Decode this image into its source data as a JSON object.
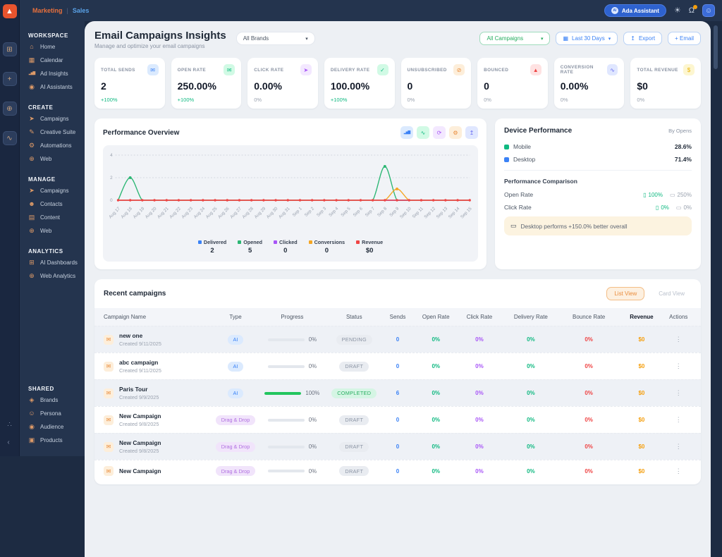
{
  "icons": {
    "logo": "▲",
    "grid": "⊞",
    "plus": "+",
    "globe": "⊕",
    "chart-line": "∿",
    "share": "∴",
    "collapse": "‹",
    "home": "⌂",
    "calendar": "▦",
    "ad-insights": "▂▅▇",
    "ai-assistants": "◉",
    "campaigns": "➤",
    "creative-suite": "✎",
    "automations": "⚙",
    "web": "⊕",
    "contacts": "☻",
    "content": "▤",
    "ai-dashboards": "⊞",
    "web-analytics": "⊕",
    "brands": "◈",
    "persona": "☺",
    "audience": "◉",
    "products": "▣",
    "envelope": "✉",
    "envelope-open": "✉",
    "cursor": "➤",
    "check": "✓",
    "user-minus": "⊘",
    "warning": "▲",
    "dollar": "$",
    "bar-chart": "▂▅▇",
    "refresh": "⟳",
    "settings": "⚙",
    "export": "↥",
    "sun": "☀",
    "bell": "Ω",
    "avatar": "☺",
    "dots": "⋮",
    "phone": "▯",
    "monitor": "▭",
    "chevron-down": "▾",
    "mail-row": "✉"
  },
  "topbar": {
    "nav": [
      {
        "label": "Marketing"
      },
      {
        "label": "Sales"
      }
    ],
    "divider": "|",
    "ai_badge": "AI",
    "ada_assistant": "Ada Assistant"
  },
  "rail": {
    "items": [
      {
        "icon": "grid"
      },
      {
        "icon": "plus"
      },
      {
        "icon": "globe"
      },
      {
        "icon": "chart-line"
      }
    ],
    "bottom": [
      {
        "icon": "share"
      },
      {
        "icon": "collapse"
      }
    ]
  },
  "sidebar": {
    "sections": [
      {
        "title": "WORKSPACE",
        "items": [
          {
            "icon": "home",
            "label": "Home"
          },
          {
            "icon": "calendar",
            "label": "Calendar"
          },
          {
            "icon": "ad-insights",
            "label": "Ad Insights"
          },
          {
            "icon": "ai-assistants",
            "label": "AI Assistants"
          }
        ]
      },
      {
        "title": "CREATE",
        "items": [
          {
            "icon": "campaigns",
            "label": "Campaigns"
          },
          {
            "icon": "creative-suite",
            "label": "Creative Suite"
          },
          {
            "icon": "automations",
            "label": "Automations"
          },
          {
            "icon": "web",
            "label": "Web"
          }
        ]
      },
      {
        "title": "MANAGE",
        "items": [
          {
            "icon": "campaigns",
            "label": "Campaigns"
          },
          {
            "icon": "contacts",
            "label": "Contacts"
          },
          {
            "icon": "content",
            "label": "Content"
          },
          {
            "icon": "web",
            "label": "Web"
          }
        ]
      },
      {
        "title": "ANALYTICS",
        "items": [
          {
            "icon": "ai-dashboards",
            "label": "AI Dashboards"
          },
          {
            "icon": "web-analytics",
            "label": "Web Analytics"
          }
        ]
      },
      {
        "title": "SHARED",
        "items": [
          {
            "icon": "brands",
            "label": "Brands"
          },
          {
            "icon": "persona",
            "label": "Persona"
          },
          {
            "icon": "audience",
            "label": "Audience"
          },
          {
            "icon": "products",
            "label": "Products"
          }
        ]
      }
    ]
  },
  "header": {
    "title": "Email Campaigns Insights",
    "subtitle": "Manage and optimize your email campaigns",
    "brand_filter": "All Brands",
    "campaign_filter": "All Campaigns",
    "date_filter": "Last 30 Days",
    "export_label": "Export",
    "email_label": "+ Email"
  },
  "stats": [
    {
      "label": "TOTAL SENDS",
      "value": "2",
      "change": "+100%",
      "positive": true,
      "icon": "envelope",
      "accent": "#3b82f6",
      "accent_bg": "#dbeafe"
    },
    {
      "label": "OPEN RATE",
      "value": "250.00%",
      "change": "+100%",
      "positive": true,
      "icon": "envelope-open",
      "accent": "#10b981",
      "accent_bg": "#d1fae5"
    },
    {
      "label": "CLICK RATE",
      "value": "0.00%",
      "change": "0%",
      "positive": false,
      "icon": "cursor",
      "accent": "#a855f7",
      "accent_bg": "#f3e8ff"
    },
    {
      "label": "DELIVERY RATE",
      "value": "100.00%",
      "change": "+100%",
      "positive": true,
      "icon": "check",
      "accent": "#10b981",
      "accent_bg": "#d1fae5"
    },
    {
      "label": "UNSUBSCRIBED",
      "value": "0",
      "change": "0%",
      "positive": false,
      "icon": "user-minus",
      "accent": "#e98b3a",
      "accent_bg": "#fdeeda"
    },
    {
      "label": "BOUNCED",
      "value": "0",
      "change": "0%",
      "positive": false,
      "icon": "warning",
      "accent": "#ef4444",
      "accent_bg": "#fee2e2"
    },
    {
      "label": "CONVERSION RATE",
      "value": "0.00%",
      "change": "0%",
      "positive": false,
      "icon": "chart-line",
      "accent": "#6366f1",
      "accent_bg": "#e0e7ff"
    },
    {
      "label": "TOTAL REVENUE",
      "value": "$0",
      "change": "0%",
      "positive": false,
      "icon": "dollar",
      "accent": "#eab308",
      "accent_bg": "#fdf6d0"
    }
  ],
  "performance": {
    "title": "Performance Overview",
    "actions": [
      {
        "icon": "bar-chart",
        "accent": "#3b82f6",
        "bg": "#dbeafe"
      },
      {
        "icon": "chart-line",
        "accent": "#10b981",
        "bg": "#d1fae5"
      },
      {
        "icon": "refresh",
        "accent": "#a855f7",
        "bg": "#f3e8ff"
      },
      {
        "icon": "settings",
        "accent": "#e98b3a",
        "bg": "#fdeeda"
      },
      {
        "icon": "export",
        "accent": "#6366f1",
        "bg": "#e0e7ff"
      }
    ]
  },
  "chart_data": {
    "type": "line",
    "title": "Performance Overview",
    "x": [
      "Aug 17",
      "Aug 18",
      "Aug 19",
      "Aug 20",
      "Aug 21",
      "Aug 22",
      "Aug 23",
      "Aug 24",
      "Aug 25",
      "Aug 26",
      "Aug 27",
      "Aug 28",
      "Aug 29",
      "Aug 30",
      "Aug 31",
      "Sep 1",
      "Sep 2",
      "Sep 3",
      "Sep 4",
      "Sep 5",
      "Sep 6",
      "Sep 7",
      "Sep 8",
      "Sep 9",
      "Sep 10",
      "Sep 11",
      "Sep 12",
      "Sep 13",
      "Sep 14",
      "Sep 15"
    ],
    "ylim": [
      0,
      4
    ],
    "yticks": [
      0,
      2,
      4
    ],
    "grid": "dashed",
    "legend_position": "bottom",
    "series": [
      {
        "name": "Delivered",
        "color": "#3b82f6",
        "total": "2",
        "values": [
          0,
          0,
          0,
          0,
          0,
          0,
          0,
          0,
          0,
          0,
          0,
          0,
          0,
          0,
          0,
          0,
          0,
          0,
          0,
          0,
          0,
          0,
          0,
          0,
          0,
          0,
          0,
          0,
          0,
          0
        ]
      },
      {
        "name": "Opened",
        "color": "#2bb673",
        "total": "5",
        "values": [
          0,
          2,
          0,
          0,
          0,
          0,
          0,
          0,
          0,
          0,
          0,
          0,
          0,
          0,
          0,
          0,
          0,
          0,
          0,
          0,
          0,
          0,
          3,
          0,
          0,
          0,
          0,
          0,
          0,
          0
        ]
      },
      {
        "name": "Clicked",
        "color": "#a855f7",
        "total": "0",
        "values": [
          0,
          0,
          0,
          0,
          0,
          0,
          0,
          0,
          0,
          0,
          0,
          0,
          0,
          0,
          0,
          0,
          0,
          0,
          0,
          0,
          0,
          0,
          0,
          0,
          0,
          0,
          0,
          0,
          0,
          0
        ]
      },
      {
        "name": "Conversions",
        "color": "#f5a623",
        "total": "0",
        "values": [
          0,
          0,
          0,
          0,
          0,
          0,
          0,
          0,
          0,
          0,
          0,
          0,
          0,
          0,
          0,
          0,
          0,
          0,
          0,
          0,
          0,
          0,
          0,
          1,
          0,
          0,
          0,
          0,
          0,
          0
        ]
      },
      {
        "name": "Revenue",
        "color": "#ef4444",
        "total": "$0",
        "values": [
          0,
          0,
          0,
          0,
          0,
          0,
          0,
          0,
          0,
          0,
          0,
          0,
          0,
          0,
          0,
          0,
          0,
          0,
          0,
          0,
          0,
          0,
          0,
          0,
          0,
          0,
          0,
          0,
          0,
          0
        ],
        "markers": true
      }
    ]
  },
  "device": {
    "title": "Device Performance",
    "byline": "By Opens",
    "legend": [
      {
        "label": "Mobile",
        "color": "#10b981",
        "value": "28.6%"
      },
      {
        "label": "Desktop",
        "color": "#3b82f6",
        "value": "71.4%"
      }
    ],
    "comparison_title": "Performance Comparison",
    "comparison": [
      {
        "label": "Open Rate",
        "mobile": "100%",
        "desktop": "250%"
      },
      {
        "label": "Click Rate",
        "mobile": "0%",
        "desktop": "0%"
      }
    ],
    "banner": "Desktop performs +150.0% better overall"
  },
  "table": {
    "title": "Recent campaigns",
    "views": [
      {
        "label": "List View",
        "active": true
      },
      {
        "label": "Card View",
        "active": false
      }
    ],
    "columns": [
      "Campaign Name",
      "Type",
      "Progress",
      "Status",
      "Sends",
      "Open Rate",
      "Click Rate",
      "Delivery Rate",
      "Bounce Rate",
      "Revenue",
      "Actions"
    ],
    "rows": [
      {
        "name": "new one",
        "created": "Created 9/11/2025",
        "type": "AI",
        "progress": "0%",
        "progress_pct": 0,
        "status": "PENDING",
        "sends": "0",
        "open_rate": "0%",
        "click_rate": "0%",
        "delivery_rate": "0%",
        "bounce_rate": "0%",
        "revenue": "$0"
      },
      {
        "name": "abc campaign",
        "created": "Created 9/11/2025",
        "type": "AI",
        "progress": "0%",
        "progress_pct": 0,
        "status": "DRAFT",
        "sends": "0",
        "open_rate": "0%",
        "click_rate": "0%",
        "delivery_rate": "0%",
        "bounce_rate": "0%",
        "revenue": "$0"
      },
      {
        "name": "Paris Tour",
        "created": "Created 9/9/2025",
        "type": "AI",
        "progress": "100%",
        "progress_pct": 100,
        "status": "COMPLETED",
        "sends": "6",
        "open_rate": "0%",
        "click_rate": "0%",
        "delivery_rate": "0%",
        "bounce_rate": "0%",
        "revenue": "$0"
      },
      {
        "name": "New Campaign",
        "created": "Created 9/8/2025",
        "type": "Drag & Drop",
        "progress": "0%",
        "progress_pct": 0,
        "status": "DRAFT",
        "sends": "0",
        "open_rate": "0%",
        "click_rate": "0%",
        "delivery_rate": "0%",
        "bounce_rate": "0%",
        "revenue": "$0"
      },
      {
        "name": "New Campaign",
        "created": "Created 9/8/2025",
        "type": "Drag & Drop",
        "progress": "0%",
        "progress_pct": 0,
        "status": "DRAFT",
        "sends": "0",
        "open_rate": "0%",
        "click_rate": "0%",
        "delivery_rate": "0%",
        "bounce_rate": "0%",
        "revenue": "$0"
      },
      {
        "name": "New Campaign",
        "created": "",
        "type": "Drag & Drop",
        "progress": "0%",
        "progress_pct": 0,
        "status": "DRAFT",
        "sends": "0",
        "open_rate": "0%",
        "click_rate": "0%",
        "delivery_rate": "0%",
        "bounce_rate": "0%",
        "revenue": "$0"
      }
    ]
  }
}
